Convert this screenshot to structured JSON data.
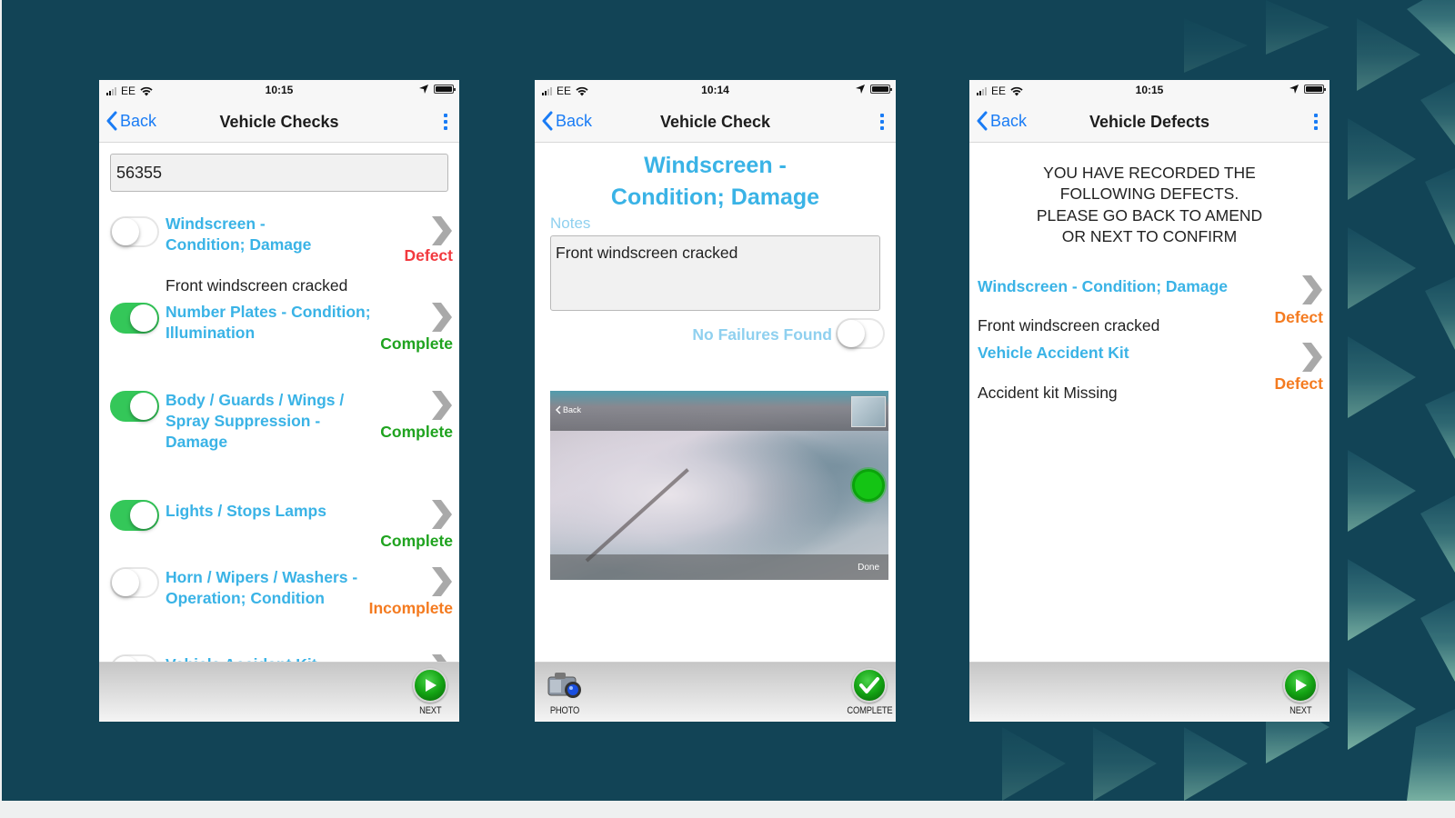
{
  "colors": {
    "background": "#124456",
    "accent_blue": "#3ab3e6",
    "ios_blue": "#1a7cf5",
    "complete_green": "#1fa31f",
    "defect_red": "#f2393e",
    "defect_orange": "#f47b20",
    "incomplete_orange": "#f47b20",
    "toggle_on": "#34c759"
  },
  "phones": [
    {
      "status": {
        "carrier": "EE",
        "time": "10:15"
      },
      "nav": {
        "back_label": "Back",
        "title": "Vehicle Checks"
      },
      "vehicle_number": "56355",
      "items": [
        {
          "title": "Windscreen - Condition; Damage",
          "toggle_on": false,
          "status": "Defect",
          "note": "Front windscreen cracked"
        },
        {
          "title": "Number Plates - Condition; Illumination",
          "toggle_on": true,
          "status": "Complete"
        },
        {
          "title": "Body / Guards / Wings / Spray Suppression - Damage",
          "toggle_on": true,
          "status": "Complete"
        },
        {
          "title": "Lights / Stops Lamps",
          "toggle_on": true,
          "status": "Complete"
        },
        {
          "title": "Horn / Wipers / Washers - Operation; Condition",
          "toggle_on": false,
          "status": "Incomplete"
        },
        {
          "title": "Vehicle Accident Kit",
          "toggle_on": false,
          "status": ""
        }
      ],
      "toolbar": {
        "next_label": "NEXT"
      }
    },
    {
      "status": {
        "carrier": "EE",
        "time": "10:14"
      },
      "nav": {
        "back_label": "Back",
        "title": "Vehicle Check"
      },
      "check_title_line1": "Windscreen -",
      "check_title_line2": "Condition; Damage",
      "notes_label": "Notes",
      "notes_value": "Front windscreen cracked",
      "no_failures_label": "No Failures Found",
      "no_failures_on": false,
      "photo": {
        "back_label": "Back",
        "done_label": "Done"
      },
      "toolbar": {
        "photo_label": "PHOTO",
        "complete_label": "COMPLETE"
      }
    },
    {
      "status": {
        "carrier": "EE",
        "time": "10:15"
      },
      "nav": {
        "back_label": "Back",
        "title": "Vehicle Defects"
      },
      "message_lines": [
        "YOU HAVE RECORDED THE",
        "FOLLOWING DEFECTS.",
        "PLEASE GO BACK TO AMEND",
        "OR NEXT TO CONFIRM"
      ],
      "defects": [
        {
          "title": "Windscreen - Condition; Damage",
          "note": "Front windscreen cracked",
          "status": "Defect"
        },
        {
          "title": "Vehicle Accident Kit",
          "note": "Accident kit Missing",
          "status": "Defect"
        }
      ],
      "toolbar": {
        "next_label": "NEXT"
      }
    }
  ]
}
